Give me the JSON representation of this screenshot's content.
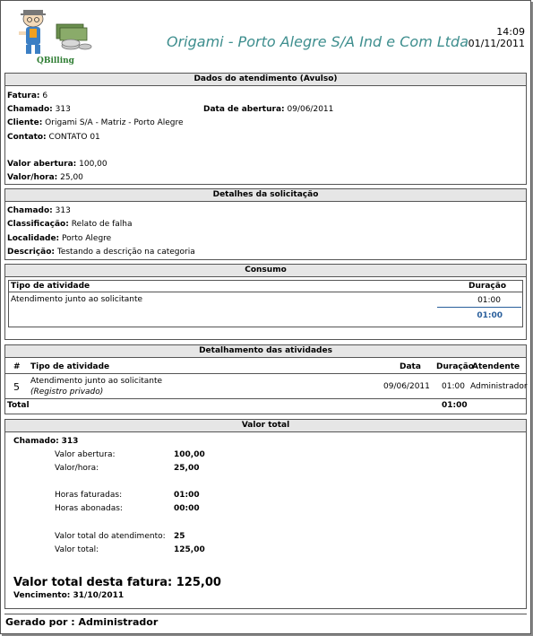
{
  "header": {
    "logo_text": "QBilling",
    "company": "Origami - Porto Alegre S/A Ind e Com Ltda",
    "time": "14:09",
    "date": "01/11/2011"
  },
  "dados": {
    "title": "Dados do atendimento (Avulso)",
    "fatura_label": "Fatura:",
    "fatura_value": "6",
    "chamado_label": "Chamado:",
    "chamado_value": "313",
    "abertura_label": "Data de abertura:",
    "abertura_value": "09/06/2011",
    "cliente_label": "Cliente:",
    "cliente_value": "Origami S/A - Matriz - Porto Alegre",
    "contato_label": "Contato:",
    "contato_value": "CONTATO 01",
    "valor_abertura_label": "Valor abertura:",
    "valor_abertura_value": "100,00",
    "valor_hora_label": "Valor/hora:",
    "valor_hora_value": "25,00"
  },
  "detalhes": {
    "title": "Detalhes da solicitação",
    "chamado_label": "Chamado:",
    "chamado_value": "313",
    "classificacao_label": "Classificação:",
    "classificacao_value": "Relato de falha",
    "localidade_label": "Localidade:",
    "localidade_value": "Porto Alegre",
    "descricao_label": "Descrição:",
    "descricao_value": "Testando a descrição na categoria"
  },
  "consumo": {
    "title": "Consumo",
    "col_tipo": "Tipo de atividade",
    "col_duracao": "Duração",
    "row_tipo": "Atendimento junto ao solicitante",
    "row_duracao": "01:00",
    "total_duracao": "01:00"
  },
  "detalhamento": {
    "title": "Detalhamento das atividades",
    "col_num": "#",
    "col_tipo": "Tipo de atividade",
    "col_data": "Data",
    "col_duracao": "Duração",
    "col_atendente": "Atendente",
    "row_num": "5",
    "row_tipo": "Atendimento junto ao solicitante",
    "row_nota": "(Registro privado)",
    "row_data": "09/06/2011",
    "row_duracao": "01:00",
    "row_atendente": "Administrador",
    "total_label": "Total",
    "total_duracao": "01:00"
  },
  "valor_total": {
    "title": "Valor total",
    "chamado_label": "Chamado:",
    "chamado_value": "313",
    "valor_abertura_label": "Valor abertura:",
    "valor_abertura_value": "100,00",
    "valor_hora_label": "Valor/hora:",
    "valor_hora_value": "25,00",
    "horas_faturadas_label": "Horas faturadas:",
    "horas_faturadas_value": "01:00",
    "horas_abonadas_label": "Horas abonadas:",
    "horas_abonadas_value": "00:00",
    "valor_total_atend_label": "Valor total do atendimento:",
    "valor_total_atend_value": "25",
    "valor_total_label": "Valor total:",
    "valor_total_value": "125,00",
    "fatura_total": "Valor total desta fatura: 125,00",
    "vencimento": "Vencimento: 31/10/2011"
  },
  "footer": {
    "gerado_por": "Gerado por : Administrador"
  },
  "colors": {
    "company": "#3e8e8e",
    "duration_blue": "#2a5f9c",
    "section_header_bg": "#e6e6e6"
  }
}
